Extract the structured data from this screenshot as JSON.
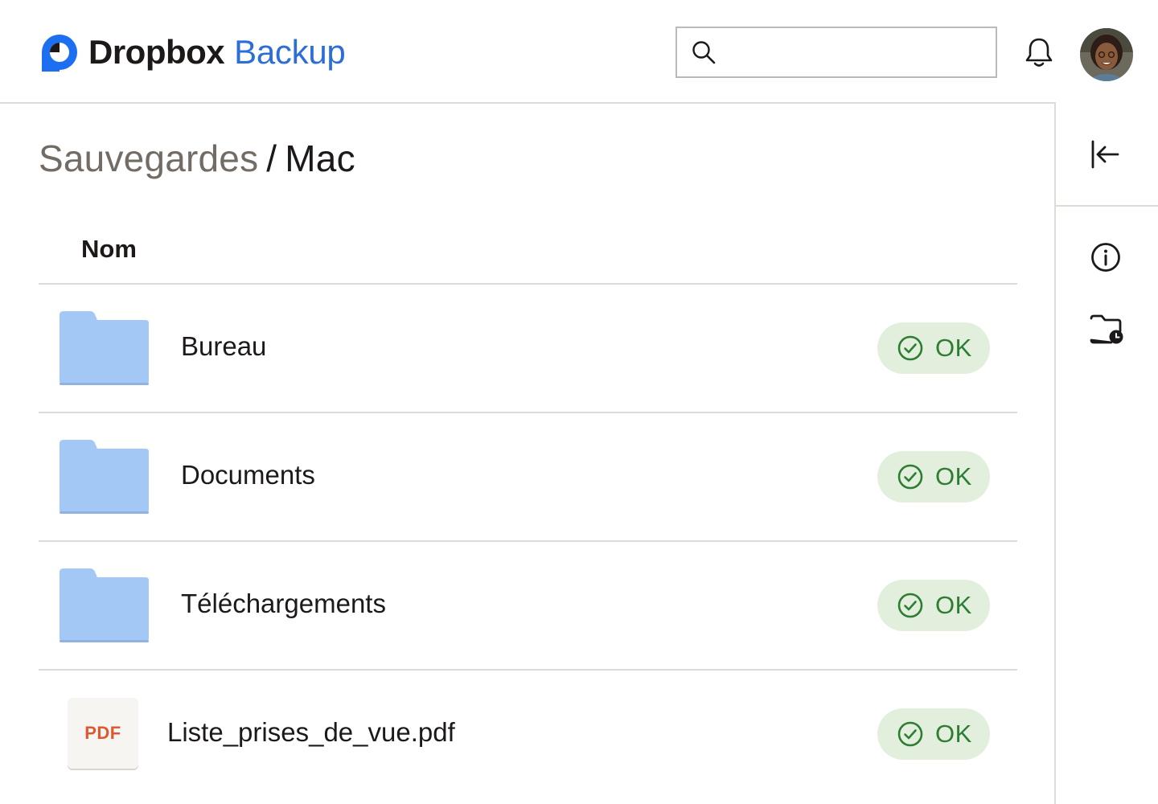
{
  "header": {
    "brand": "Dropbox",
    "product": "Backup",
    "search": {
      "placeholder": "",
      "value": ""
    },
    "icons": {
      "search": "search-icon",
      "notifications": "bell-icon",
      "avatar": "user-avatar"
    }
  },
  "breadcrumb": {
    "parent": "Sauvegardes",
    "separator": "/",
    "current": "Mac"
  },
  "table": {
    "columns": [
      "Nom"
    ],
    "rows": [
      {
        "name": "Bureau",
        "type": "folder",
        "status": "OK"
      },
      {
        "name": "Documents",
        "type": "folder",
        "status": "OK"
      },
      {
        "name": "Téléchargements",
        "type": "folder",
        "status": "OK"
      },
      {
        "name": "Liste_prises_de_vue.pdf",
        "type": "file",
        "file_badge": "PDF",
        "status": "OK"
      }
    ]
  },
  "right_rail": {
    "icons": [
      "collapse-panel-icon",
      "info-icon",
      "folder-history-icon"
    ]
  },
  "colors": {
    "brand_blue": "#2b6ed8",
    "brand_text": "#1e1919",
    "folder_blue": "#a4c8f5",
    "status_bg": "#e2efdd",
    "status_green": "#2e7d32",
    "pdf_red": "#dd5933",
    "divider": "#dedbd6"
  }
}
